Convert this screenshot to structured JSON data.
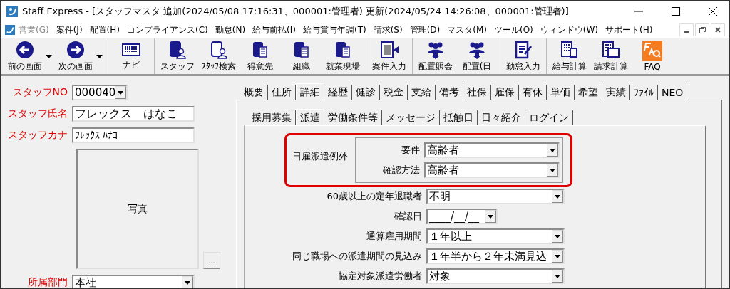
{
  "window": {
    "title": "Staff Express - [スタッフマスタ  追加(2024/05/08 17:16:31、000001:管理者)  更新(2024/05/24 14:26:08、000001:管理者)]"
  },
  "menu": [
    {
      "label": "営業(G)",
      "disabled": true
    },
    {
      "label": "案件(J)",
      "disabled": false
    },
    {
      "label": "配置(H)",
      "disabled": false
    },
    {
      "label": "コンプライアンス(C)",
      "disabled": false
    },
    {
      "label": "勤怠(N)",
      "disabled": false
    },
    {
      "label": "給与前払(I)",
      "disabled": false
    },
    {
      "label": "給与賞与年調(T)",
      "disabled": false
    },
    {
      "label": "請求(S)",
      "disabled": false
    },
    {
      "label": "管理(D)",
      "disabled": false
    },
    {
      "label": "マスタ(M)",
      "disabled": false
    },
    {
      "label": "ツール(O)",
      "disabled": false
    },
    {
      "label": "ウィンドウ(W)",
      "disabled": false
    },
    {
      "label": "サポート(H)",
      "disabled": false
    }
  ],
  "toolbar": [
    [
      {
        "label": "前の画面",
        "kind": "back",
        "dropdown": true
      },
      {
        "label": "次の画面",
        "kind": "forward",
        "dropdown": true
      }
    ],
    [
      {
        "label": "ナビ",
        "kind": "navi",
        "dropdown": false
      }
    ],
    [
      {
        "label": "スタッフ",
        "kind": "person",
        "dropdown": false
      },
      {
        "label": "ｽﾀｯﾌ検索",
        "kind": "search",
        "dropdown": false
      },
      {
        "label": "得意先",
        "kind": "building",
        "dropdown": false
      },
      {
        "label": "組織",
        "kind": "building",
        "dropdown": false
      },
      {
        "label": "就業現場",
        "kind": "building",
        "dropdown": false
      }
    ],
    [
      {
        "label": "案件入力",
        "kind": "doc",
        "dropdown": false
      }
    ],
    [
      {
        "label": "配置照会",
        "kind": "group",
        "dropdown": false
      },
      {
        "label": "配置(日",
        "kind": "group",
        "dropdown": false
      }
    ],
    [
      {
        "label": "勤怠入力",
        "kind": "edit",
        "dropdown": false
      }
    ],
    [
      {
        "label": "給与計算",
        "kind": "calc",
        "dropdown": false
      },
      {
        "label": "請求計算",
        "kind": "calc2",
        "dropdown": false
      },
      {
        "label": "FAQ",
        "kind": "faq",
        "dropdown": false
      }
    ]
  ],
  "staff": {
    "fields": [
      {
        "label": "スタッフNO",
        "value": "000040",
        "kind": "combo"
      },
      {
        "label": "スタッフ氏名",
        "value": "フレックス　はなこ",
        "kind": "text"
      },
      {
        "label": "スタッフカナ",
        "value": "ﾌﾚｯｸｽ ﾊﾅｺ",
        "kind": "text"
      }
    ],
    "photo": {
      "label": "写真",
      "button": "..."
    },
    "department": {
      "label": "所属部門",
      "value": "本社"
    }
  },
  "tabs": [
    {
      "label": "概要",
      "selected": false
    },
    {
      "label": "住所",
      "selected": false
    },
    {
      "label": "詳細",
      "selected": true
    },
    {
      "label": "経歴",
      "selected": false
    },
    {
      "label": "健診",
      "selected": false
    },
    {
      "label": "税金",
      "selected": false
    },
    {
      "label": "支給",
      "selected": false
    },
    {
      "label": "備考",
      "selected": false
    },
    {
      "label": "社保",
      "selected": false
    },
    {
      "label": "雇保",
      "selected": false
    },
    {
      "label": "有休",
      "selected": false
    },
    {
      "label": "単価",
      "selected": false
    },
    {
      "label": "希望",
      "selected": false
    },
    {
      "label": "実績",
      "selected": false
    },
    {
      "label": "ﾌｧｲﾙ",
      "selected": false
    },
    {
      "label": "NEO",
      "selected": false
    }
  ],
  "subtabs": [
    {
      "label": "採用募集",
      "selected": false
    },
    {
      "label": "派遣",
      "selected": true
    },
    {
      "label": "労働条件等",
      "selected": false
    },
    {
      "label": "メッセージ",
      "selected": false
    },
    {
      "label": "抵触日",
      "selected": false
    },
    {
      "label": "日々紹介",
      "selected": false
    },
    {
      "label": "ログイン",
      "selected": false
    }
  ],
  "exception_group": {
    "label": "日雇派遣例外",
    "highlighted": true,
    "rows": [
      {
        "label": "要件",
        "value": "高齢者"
      },
      {
        "label": "確認方法",
        "value": "高齢者"
      }
    ]
  },
  "form": [
    {
      "label": "60歳以上の定年退職者",
      "value": "不明",
      "kind": "select"
    },
    {
      "label": "確認日",
      "value": "____/__/__",
      "kind": "date"
    },
    {
      "label": "通算雇用期間",
      "value": "１年以上",
      "kind": "select"
    },
    {
      "label": "同じ職場への派遣期間の見込み",
      "value": "１年半から２年未満見込",
      "kind": "select"
    },
    {
      "label": "協定対象派遣労働者",
      "value": "対象",
      "kind": "select"
    }
  ]
}
